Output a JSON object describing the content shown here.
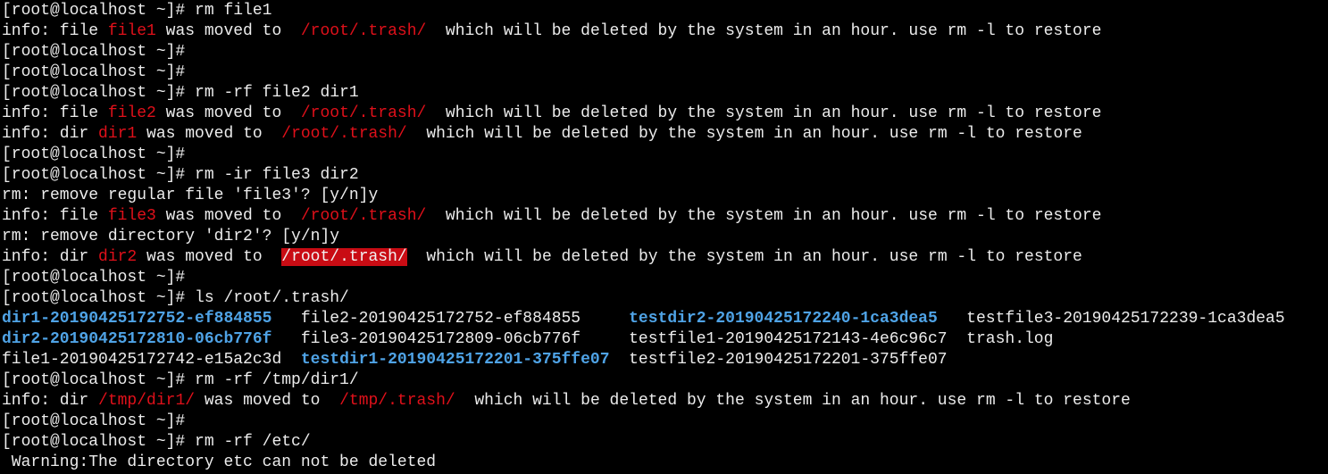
{
  "terminal": {
    "lines": [
      [
        {
          "t": "[root@localhost ~]# rm file1"
        }
      ],
      [
        {
          "t": "info: file "
        },
        {
          "t": "file1",
          "s": "red"
        },
        {
          "t": " was moved to  "
        },
        {
          "t": "/root/.trash/",
          "s": "red"
        },
        {
          "t": "  which will be deleted by the system in an hour. use rm -l to restore"
        }
      ],
      [
        {
          "t": "[root@localhost ~]#"
        }
      ],
      [
        {
          "t": "[root@localhost ~]#"
        }
      ],
      [
        {
          "t": "[root@localhost ~]# rm -rf file2 dir1"
        }
      ],
      [
        {
          "t": "info: file "
        },
        {
          "t": "file2",
          "s": "red"
        },
        {
          "t": " was moved to  "
        },
        {
          "t": "/root/.trash/",
          "s": "red"
        },
        {
          "t": "  which will be deleted by the system in an hour. use rm -l to restore"
        }
      ],
      [
        {
          "t": "info: dir "
        },
        {
          "t": "dir1",
          "s": "red"
        },
        {
          "t": " was moved to  "
        },
        {
          "t": "/root/.trash/",
          "s": "red"
        },
        {
          "t": "  which will be deleted by the system in an hour. use rm -l to restore"
        }
      ],
      [
        {
          "t": "[root@localhost ~]#"
        }
      ],
      [
        {
          "t": "[root@localhost ~]# rm -ir file3 dir2"
        }
      ],
      [
        {
          "t": "rm: remove regular file 'file3'? [y/n]y"
        }
      ],
      [
        {
          "t": "info: file "
        },
        {
          "t": "file3",
          "s": "red"
        },
        {
          "t": " was moved to  "
        },
        {
          "t": "/root/.trash/",
          "s": "red"
        },
        {
          "t": "  which will be deleted by the system in an hour. use rm -l to restore"
        }
      ],
      [
        {
          "t": "rm: remove directory 'dir2'? [y/n]y"
        }
      ],
      [
        {
          "t": "info: dir "
        },
        {
          "t": "dir2",
          "s": "red"
        },
        {
          "t": " was moved to  "
        },
        {
          "t": "/root/.trash/",
          "s": "redbg"
        },
        {
          "t": "  which will be deleted by the system in an hour. use rm -l to restore"
        }
      ],
      [
        {
          "t": "[root@localhost ~]#"
        }
      ],
      [
        {
          "t": "[root@localhost ~]# ls /root/.trash/"
        }
      ],
      [
        {
          "t": "dir1-20190425172752-ef884855",
          "s": "blue"
        },
        {
          "t": "   file2-20190425172752-ef884855     "
        },
        {
          "t": "testdir2-20190425172240-1ca3dea5",
          "s": "blue"
        },
        {
          "t": "   testfile3-20190425172239-1ca3dea5"
        }
      ],
      [
        {
          "t": "dir2-20190425172810-06cb776f",
          "s": "blue"
        },
        {
          "t": "   file3-20190425172809-06cb776f     testfile1-20190425172143-4e6c96c7  trash.log"
        }
      ],
      [
        {
          "t": "file1-20190425172742-e15a2c3d  "
        },
        {
          "t": "testdir1-20190425172201-375ffe07",
          "s": "blue"
        },
        {
          "t": "  testfile2-20190425172201-375ffe07"
        }
      ],
      [
        {
          "t": "[root@localhost ~]# rm -rf /tmp/dir1/"
        }
      ],
      [
        {
          "t": "info: dir "
        },
        {
          "t": "/tmp/dir1/",
          "s": "red"
        },
        {
          "t": " was moved to  "
        },
        {
          "t": "/tmp/.trash/",
          "s": "red"
        },
        {
          "t": "  which will be deleted by the system in an hour. use rm -l to restore"
        }
      ],
      [
        {
          "t": "[root@localhost ~]#"
        }
      ],
      [
        {
          "t": "[root@localhost ~]# rm -rf /etc/"
        }
      ],
      [
        {
          "t": " Warning:The directory etc can not be deleted"
        }
      ]
    ],
    "cursor_visible": true
  },
  "colors": {
    "background": "#000000",
    "foreground": "#ececec",
    "red": "#e0101a",
    "highlight_bg": "#c90c14",
    "directory_blue": "#4fa3e6",
    "cursor": "#24d324"
  }
}
